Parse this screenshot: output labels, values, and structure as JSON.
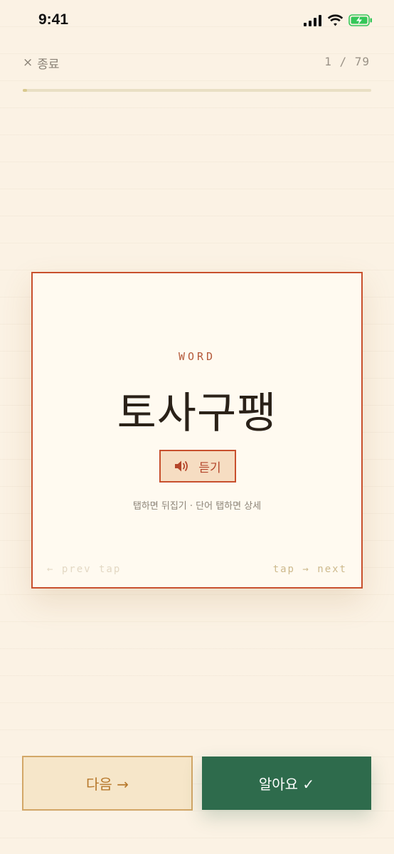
{
  "status_bar": {
    "time": "9:41",
    "icons": [
      "cellular-signal-icon",
      "wifi-icon",
      "battery-charging-icon"
    ],
    "battery_color": "#34c759"
  },
  "header": {
    "close_icon": "×",
    "close_label": "종료",
    "progress_text": "1 / 79",
    "progress_fraction": 0.0127
  },
  "card": {
    "kind_label": "WORD",
    "word": "토사구팽",
    "listen_label": "듣기",
    "hint": "탭하면 뒤집기 · 단어 탭하면 상세",
    "prev_hint": "← prev tap",
    "next_hint": "tap → next"
  },
  "actions": {
    "next_label": "다음 →",
    "know_label": "알아요 ✓"
  },
  "colors": {
    "background": "#fbf2e4",
    "accent": "#c8502d",
    "know_button": "#2e6b4c",
    "next_button_bg": "#f6e6c9",
    "next_button_text": "#b7782b"
  }
}
